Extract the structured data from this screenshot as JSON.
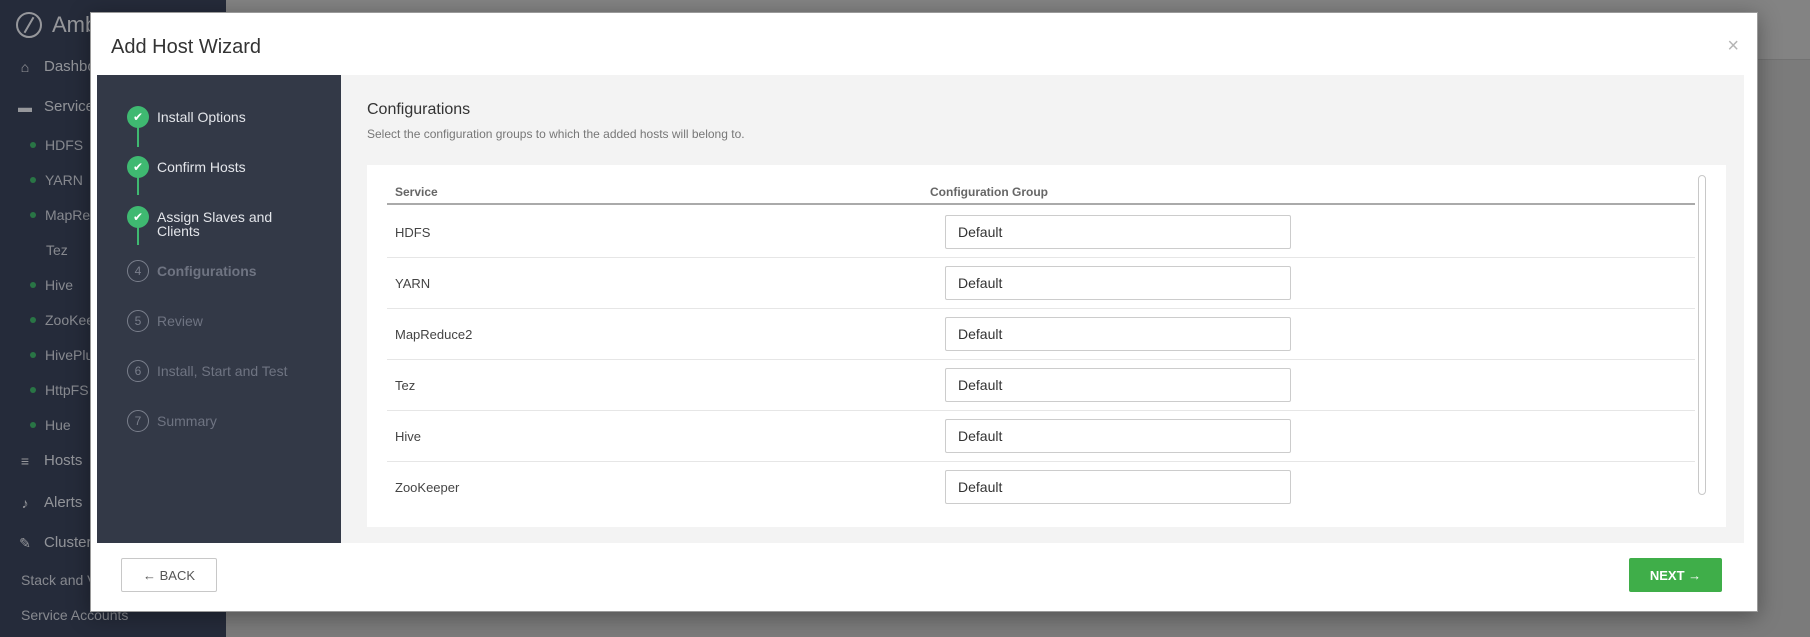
{
  "background": {
    "logo_text": "Amb",
    "nav": [
      {
        "label": "Dashbo",
        "icon": "home-icon"
      },
      {
        "label": "Service",
        "icon": "briefcase-icon"
      },
      {
        "label": "Hosts",
        "icon": "server-icon"
      },
      {
        "label": "Alerts",
        "icon": "bell-icon"
      },
      {
        "label": "Cluster",
        "icon": "wrench-icon"
      }
    ],
    "services": [
      "HDFS",
      "YARN",
      "MapRe",
      "Tez",
      "Hive",
      "ZooKee",
      "HivePlu",
      "HttpFS",
      "Hue"
    ],
    "links": [
      "Stack and V",
      "Service Accounts"
    ]
  },
  "modal": {
    "title": "Add Host Wizard",
    "close": "×"
  },
  "steps": [
    {
      "marker": "✔",
      "label": "Install Options",
      "state": "done"
    },
    {
      "marker": "✔",
      "label": "Confirm Hosts",
      "state": "done"
    },
    {
      "marker": "✔",
      "label": "Assign Slaves and Clients",
      "state": "done"
    },
    {
      "marker": "4",
      "label": "Configurations",
      "state": "current"
    },
    {
      "marker": "5",
      "label": "Review",
      "state": "todo"
    },
    {
      "marker": "6",
      "label": "Install, Start and Test",
      "state": "todo"
    },
    {
      "marker": "7",
      "label": "Summary",
      "state": "todo"
    }
  ],
  "content": {
    "title": "Configurations",
    "description": "Select the configuration groups to which the added hosts will belong to.",
    "table": {
      "headers": {
        "service": "Service",
        "group": "Configuration Group"
      },
      "rows": [
        {
          "service": "HDFS",
          "group": "Default"
        },
        {
          "service": "YARN",
          "group": "Default"
        },
        {
          "service": "MapReduce2",
          "group": "Default"
        },
        {
          "service": "Tez",
          "group": "Default"
        },
        {
          "service": "Hive",
          "group": "Default"
        },
        {
          "service": "ZooKeeper",
          "group": "Default"
        }
      ]
    }
  },
  "footer": {
    "back_label": "← BACK",
    "next_label": "NEXT →"
  }
}
